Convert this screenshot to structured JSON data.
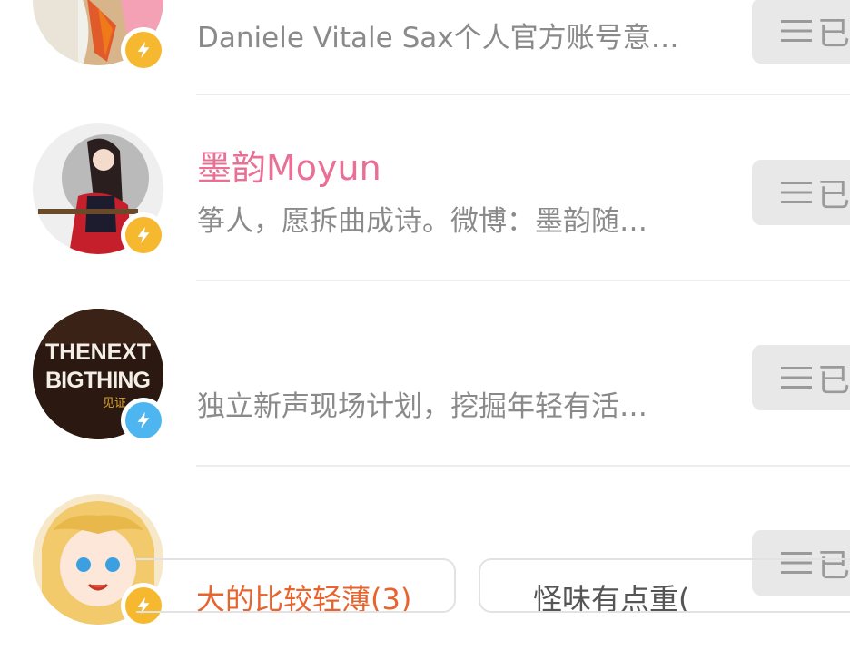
{
  "users": [
    {
      "name": "",
      "description": "Daniele Vitale Sax个人官方账号意…",
      "follow_label": "已",
      "badge": "gold-lightning",
      "badge_color": "#f5b82e"
    },
    {
      "name": "墨韵Moyun",
      "description": "筝人，愿拆曲成诗。微博：墨韵随…",
      "follow_label": "已",
      "badge": "gold-lightning",
      "badge_color": "#f5b82e"
    },
    {
      "name": "",
      "avatar_text": [
        "THENEXT",
        "BIGTHING",
        "见证"
      ],
      "description": "独立新声现场计划，挖掘年轻有活…",
      "follow_label": "已",
      "badge": "blue-lightning",
      "badge_color": "#4db6f0"
    },
    {
      "name": "",
      "description": "",
      "follow_label": "已",
      "badge": "gold-lightning",
      "badge_color": "#f5b82e"
    }
  ],
  "chips": [
    {
      "text": "大的比较轻薄(3)",
      "color": "#e8642e"
    },
    {
      "text": "怪味有点重(",
      "color": "#555555"
    }
  ],
  "colors": {
    "name_pink": "#e96f95",
    "desc_gray": "#8a8a8a",
    "button_bg": "#e8e8e8"
  }
}
